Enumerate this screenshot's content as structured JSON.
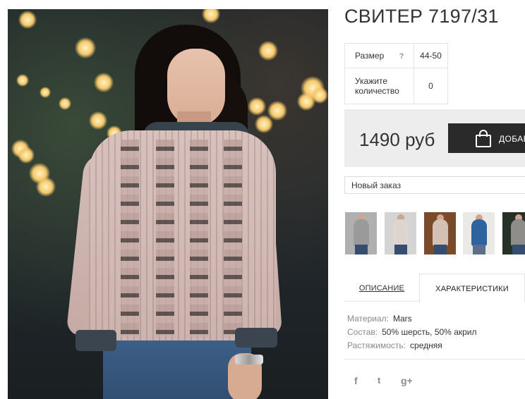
{
  "product": {
    "title": "СВИТЕР 7197/31",
    "photo_alt": "Woman wearing a pink cable-knit sweater"
  },
  "props": {
    "size_label": "Размер",
    "size_help": "?",
    "size_value": "44-50",
    "qty_label": "Укажите количество",
    "qty_value": "0"
  },
  "buy": {
    "price": "1490 руб",
    "cart_label": "ДОБАВИТЬ В КОРЗИНУ",
    "cart_icon": "shopping-bag-icon"
  },
  "order": {
    "selected": "Новый заказ"
  },
  "thumbnails": [
    {
      "bg": "#a9a9a9",
      "color": "#9a9a9a"
    },
    {
      "bg": "#cfcfcf",
      "color": "#d9d3cf"
    },
    {
      "bg": "#7a4a2a",
      "color": "#d5c0b4"
    },
    {
      "bg": "#e8e6e2",
      "color": "#2f63a0"
    },
    {
      "bg": "#263228",
      "color": "#8e8d89"
    }
  ],
  "tabs": {
    "description": "ОПИСАНИЕ",
    "characteristics": "ХАРАКТЕРИСТИКИ"
  },
  "characteristics": [
    {
      "key": "Материал:",
      "value": "Mars"
    },
    {
      "key": "Состав:",
      "value": "50% шерсть, 50% акрил"
    },
    {
      "key": "Растяжимость:",
      "value": "средняя"
    }
  ],
  "social": {
    "facebook": "f",
    "twitter": "t",
    "googleplus": "g+"
  },
  "colors": {
    "buy_bg": "#ededed",
    "button_bg": "#2a2a2a",
    "border": "#e3e3e3"
  }
}
